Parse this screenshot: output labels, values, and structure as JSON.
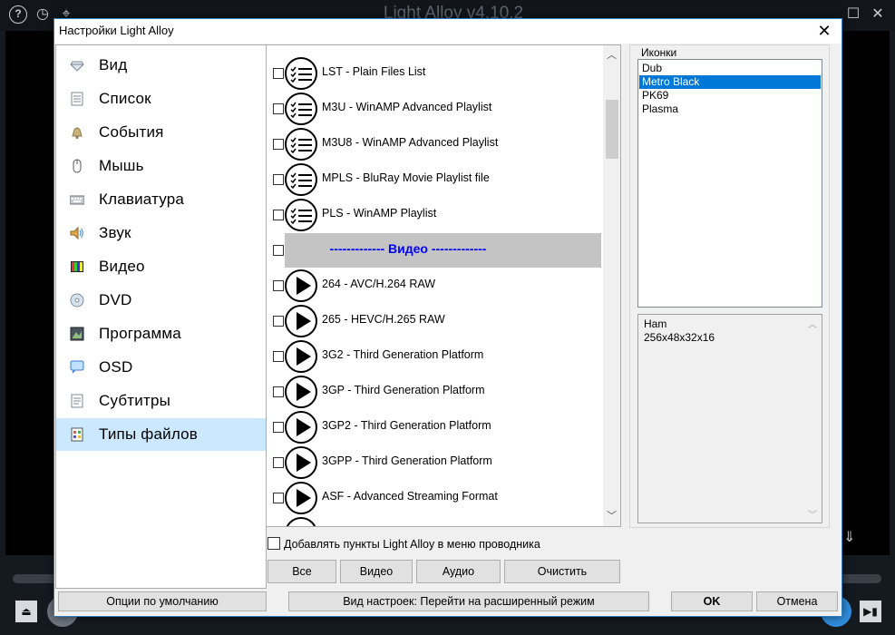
{
  "player": {
    "title": "Light Alloy v4.10.2",
    "help": "?",
    "history_glyph": "◷",
    "pin_glyph": "⌖",
    "maximize_glyph": "☐",
    "close_glyph": "✕",
    "eject_glyph": "⏏",
    "next_glyph": "▶▮"
  },
  "dialog": {
    "title": "Настройки Light Alloy",
    "close_glyph": "✕",
    "sidebar": [
      {
        "label": "Вид",
        "icon": "diamond-icon"
      },
      {
        "label": "Список",
        "icon": "list-icon"
      },
      {
        "label": "События",
        "icon": "bell-icon"
      },
      {
        "label": "Мышь",
        "icon": "mouse-icon"
      },
      {
        "label": "Клавиатура",
        "icon": "keyboard-icon"
      },
      {
        "label": "Звук",
        "icon": "speaker-icon"
      },
      {
        "label": "Видео",
        "icon": "video-icon"
      },
      {
        "label": "DVD",
        "icon": "disc-icon"
      },
      {
        "label": "Программа",
        "icon": "program-icon"
      },
      {
        "label": "OSD",
        "icon": "speech-bubble-icon"
      },
      {
        "label": "Субтитры",
        "icon": "subtitles-icon"
      },
      {
        "label": "Типы файлов",
        "icon": "file-types-icon",
        "selected": true
      }
    ],
    "file_types": [
      {
        "label": "LST - Plain Files List",
        "icon": "playlist-icon",
        "checked": false
      },
      {
        "label": "M3U - WinAMP Advanced Playlist",
        "icon": "playlist-icon",
        "checked": false
      },
      {
        "label": "M3U8 - WinAMP Advanced Playlist",
        "icon": "playlist-icon",
        "checked": false
      },
      {
        "label": "MPLS - BluRay Movie Playlist file",
        "icon": "playlist-icon",
        "checked": false
      },
      {
        "label": "PLS - WinAMP Playlist",
        "icon": "playlist-icon",
        "checked": false
      },
      {
        "label": "------------- Видео -------------",
        "section": true,
        "checked": false
      },
      {
        "label": "264 - AVC/H.264 RAW",
        "icon": "play-icon",
        "checked": false
      },
      {
        "label": "265 - HEVC/H.265 RAW",
        "icon": "play-icon",
        "checked": false
      },
      {
        "label": "3G2 - Third Generation Platform",
        "icon": "play-icon",
        "checked": false
      },
      {
        "label": "3GP - Third Generation Platform",
        "icon": "play-icon",
        "checked": false
      },
      {
        "label": "3GP2 - Third Generation Platform",
        "icon": "play-icon",
        "checked": false
      },
      {
        "label": "3GPP - Third Generation Platform",
        "icon": "play-icon",
        "checked": false
      },
      {
        "label": "ASF - Advanced Streaming Format",
        "icon": "play-icon",
        "checked": false
      }
    ],
    "icons_group": {
      "title": "Иконки",
      "items": [
        {
          "label": "Dub"
        },
        {
          "label": "Metro Black",
          "selected": true
        },
        {
          "label": "PK69"
        },
        {
          "label": "Plasma"
        }
      ],
      "info_line1": "Ham",
      "info_line2": "256x48x32x16"
    },
    "explorer_menu_checkbox": {
      "label": "Добавлять пункты Light Alloy в меню проводника",
      "checked": false
    },
    "buttons": {
      "all": "Все",
      "video": "Видео",
      "audio": "Аудио",
      "clear": "Очистить",
      "defaults": "Опции по умолчанию",
      "view_mode": "Вид настроек: Перейти на расширенный режим",
      "ok": "OK",
      "cancel": "Отмена"
    }
  }
}
